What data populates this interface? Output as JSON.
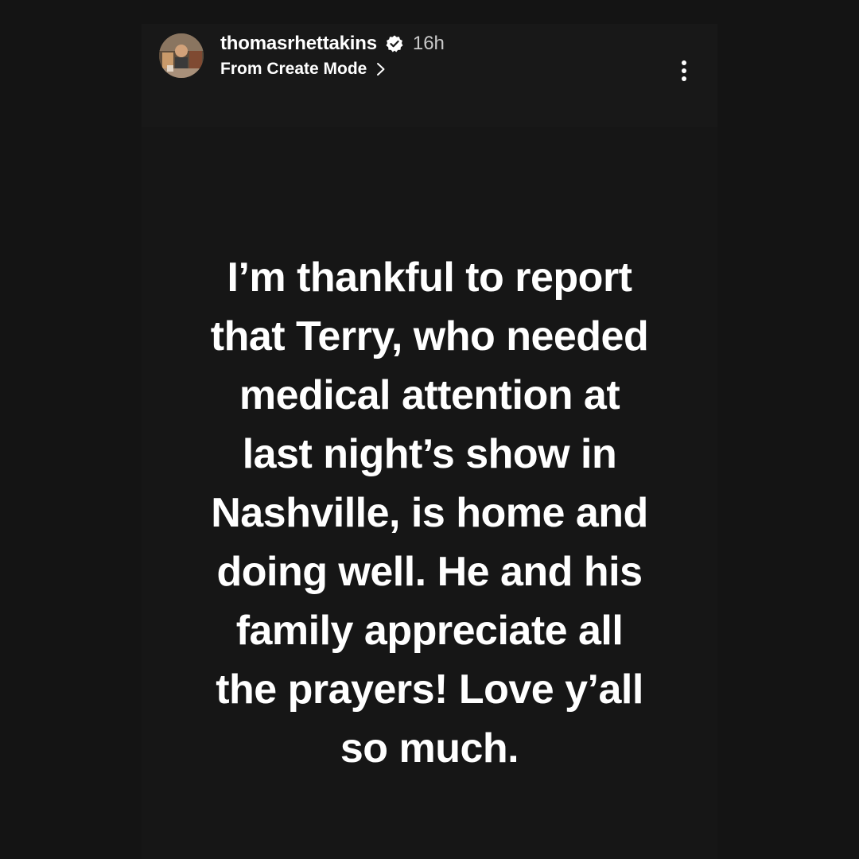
{
  "story": {
    "header": {
      "username": "thomasrhettakins",
      "verified": true,
      "timestamp": "16h",
      "subtitle": "From Create Mode"
    },
    "icons": {
      "verified": "verified-badge-icon",
      "chevron": "chevron-right-icon",
      "more": "more-options-icon"
    },
    "message_lines": [
      "I’m thankful to report",
      "that Terry, who needed",
      "medical attention at",
      "last night’s show in",
      "Nashville, is home and",
      "doing well. He and his",
      "family appreciate all",
      "the prayers! Love y’all",
      "so much."
    ]
  },
  "colors": {
    "background": "#141414",
    "header_background": "#181818",
    "text": "#ffffff",
    "timestamp": "#c9c9c9"
  }
}
